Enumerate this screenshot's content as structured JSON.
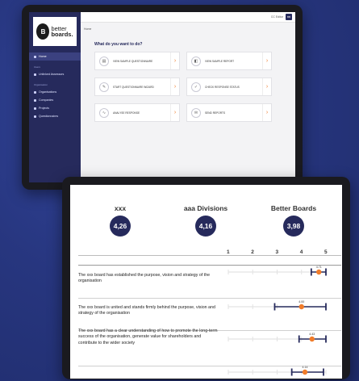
{
  "tablet1": {
    "logo": {
      "mark": "B",
      "line1": "better",
      "line2": "boards."
    },
    "topbar": {
      "user": "CC Editor",
      "avatar": "BB"
    },
    "breadcrumb": "Home",
    "sidebar": {
      "items": [
        {
          "label": "Home",
          "active": true
        },
        {
          "section": "Users"
        },
        {
          "label": "Unlinked Assessors"
        },
        {
          "section": "Organisation"
        },
        {
          "label": "Organisations"
        },
        {
          "label": "Companies"
        },
        {
          "label": "Projects"
        },
        {
          "label": "Questionnaires"
        }
      ]
    },
    "question": "What do you want to do?",
    "actions": [
      {
        "label": "VIEW SAMPLE QUESTIONNAIRE",
        "icon": "document-icon"
      },
      {
        "label": "VIEW SAMPLE REPORT",
        "icon": "report-icon"
      },
      {
        "label": "START QUESTIONNAIRE WIZARD",
        "icon": "wizard-icon"
      },
      {
        "label": "CHECK RESPONSE STATUS",
        "icon": "status-icon"
      },
      {
        "label": "ANALYSE RESPONSE",
        "icon": "analyse-icon"
      },
      {
        "label": "SEND REPORTS",
        "icon": "send-icon"
      }
    ],
    "colors": {
      "sidebar": "#262a5c",
      "accent": "#f07c2a"
    }
  },
  "tablet2": {
    "scores": [
      {
        "name": "xxx",
        "value": "4,26"
      },
      {
        "name": "aaa Divisions",
        "value": "4,16"
      },
      {
        "name": "Better Boards",
        "value": "3,98"
      }
    ],
    "scale_labels": [
      "1",
      "2",
      "3",
      "4",
      "5"
    ],
    "chart_data": {
      "type": "scatter",
      "x_range": [
        1,
        5
      ],
      "rows": [
        {
          "statement": "The xxx board has established the purpose, vision and strategy of the organisation",
          "value": 4.71,
          "value_label": "4.71",
          "range": [
            4.4,
            5.0
          ]
        },
        {
          "statement": "The xxx board is united and stands firmly behind the purpose, vision and strategy of the organisation",
          "value": 4.0,
          "value_label": "4.00",
          "range": [
            2.9,
            5.0
          ]
        },
        {
          "statement": "The xxx board has a clear understanding of how to promote the long-term success of the organisation, generate value for shareholders and contribute to the wider society",
          "value": 4.43,
          "value_label": "4.43",
          "range": [
            3.9,
            5.0
          ]
        },
        {
          "statement": "",
          "value": 4.14,
          "value_label": "4.14",
          "range": [
            3.6,
            4.9
          ]
        }
      ],
      "colors": {
        "marker": "#f07c2a",
        "range": "#262a5c"
      }
    }
  }
}
